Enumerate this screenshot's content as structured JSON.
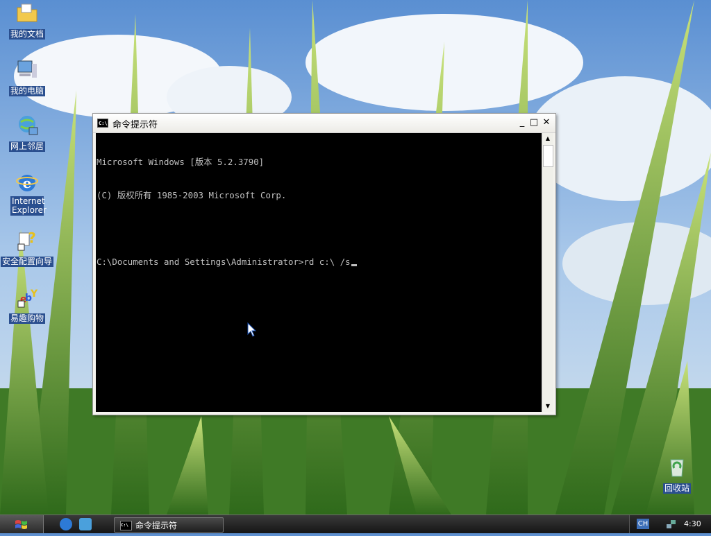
{
  "desktop": {
    "icons": [
      {
        "label": "我的文档",
        "icon": "folder-documents-icon"
      },
      {
        "label": "我的电脑",
        "icon": "computer-icon"
      },
      {
        "label": "网上邻居",
        "icon": "network-icon"
      },
      {
        "label": "Internet Explorer",
        "icon": "internet-explorer-icon"
      },
      {
        "label": "安全配置向导",
        "icon": "security-wizard-icon"
      },
      {
        "label": "易趣购物",
        "icon": "shopping-icon"
      },
      {
        "label": "回收站",
        "icon": "recycle-bin-icon"
      }
    ]
  },
  "window": {
    "title": "命令提示符",
    "icon_text": "C:\\",
    "controls": {
      "minimize": "_",
      "maximize": "□",
      "close": "✕"
    },
    "console_lines": [
      "Microsoft Windows [版本 5.2.3790]",
      "(C) 版权所有 1985-2003 Microsoft Corp.",
      "",
      "C:\\Documents and Settings\\Administrator>rd c:\\ /s"
    ]
  },
  "taskbar": {
    "task_label": "命令提示符",
    "task_icon_text": "C:\\",
    "ime": "CH",
    "clock": "4:30"
  },
  "colors": {
    "console_bg": "#000000",
    "console_fg": "#c0c0c0",
    "taskbar": "#1e1e1e",
    "icon_label_bg": "#2a4f8f"
  }
}
